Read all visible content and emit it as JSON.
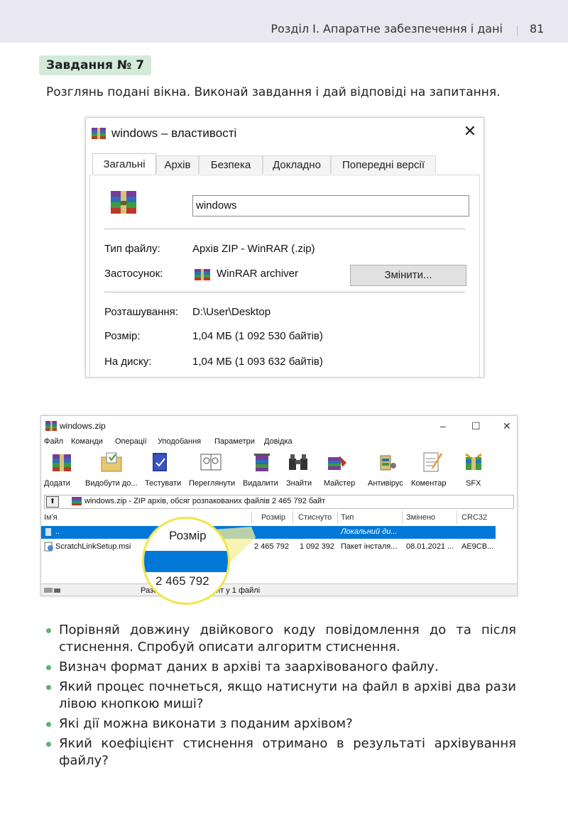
{
  "header": {
    "section_title": "Розділ І. Апаратне забезпечення і дані",
    "page_number": "81"
  },
  "task": {
    "badge": "Завдання № 7",
    "instruction": "Розглянь подані вікна. Виконай завдання і дай відповіді на запитання."
  },
  "properties_window": {
    "title": "windows – властивості",
    "close": "✕",
    "tabs": [
      "Загальні",
      "Архів",
      "Безпека",
      "Докладно",
      "Попередні версії"
    ],
    "file_name": "windows",
    "fields": {
      "type_label": "Тип файлу:",
      "type_value": "Архів ZIP - WinRAR (.zip)",
      "app_label": "Застосунок:",
      "app_value": "WinRAR archiver",
      "change_button": "Змінити...",
      "location_label": "Розташування:",
      "location_value": "D:\\User\\Desktop",
      "size_label": "Розмір:",
      "size_value": "1,04 МБ (1 092 530 байтів)",
      "disk_label": "На диску:",
      "disk_value": "1,04 МБ (1 093 632 байтів)"
    }
  },
  "winrar_window": {
    "title": "windows.zip",
    "window_buttons": [
      "–",
      "☐",
      "✕"
    ],
    "menu": [
      "Файл",
      "Команди",
      "Операції",
      "Уподобання",
      "Параметри",
      "Довідка"
    ],
    "toolbar": [
      "Додати",
      "Видобути до...",
      "Тестувати",
      "Переглянути",
      "Видалити",
      "Знайти",
      "Майстер",
      "Антивірус",
      "Коментар",
      "SFX"
    ],
    "path": "windows.zip - ZIP архів, обсяг розпакованих файлів 2 465 792 байт",
    "columns": [
      "Ім'я",
      "Розмір",
      "Стиснуто",
      "Тип",
      "Змінено",
      "CRC32"
    ],
    "rows": [
      {
        "name": "..",
        "size": "",
        "packed": "",
        "type": "Локальний ди...",
        "modified": "",
        "crc": ""
      },
      {
        "name": "ScratchLinkSetup.msi",
        "size": "2 465 792",
        "packed": "1 092 392",
        "type": "Пакет інсталя...",
        "modified": "08.01.2021 ...",
        "crc": "AE9CB..."
      }
    ],
    "status_left": "Разо",
    "status_right": "йт у 1 файлі"
  },
  "magnifier": {
    "header": "Розмір",
    "value": "2 465 792"
  },
  "questions": [
    "Порівняй довжину двійкового коду повідомлення до та після стиснення. Спробуй описати алгоритм стиснення.",
    "Визнач формат даних в архіві та заархівованого файлу.",
    "Який процес почнеться, якщо натиснути на файл в архіві два рази лівою кнопкою миші?",
    "Які дії можна виконати з поданим архівом?",
    "Який коефіцієнт стиснення отримано в результаті архівування файлу?"
  ],
  "colors": {
    "header_bg": "#e9e7ef",
    "badge_bg": "#d4ead9",
    "bullet": "#5fb26f",
    "selection": "#0078d7",
    "magnifier_border": "#f1e64a"
  }
}
